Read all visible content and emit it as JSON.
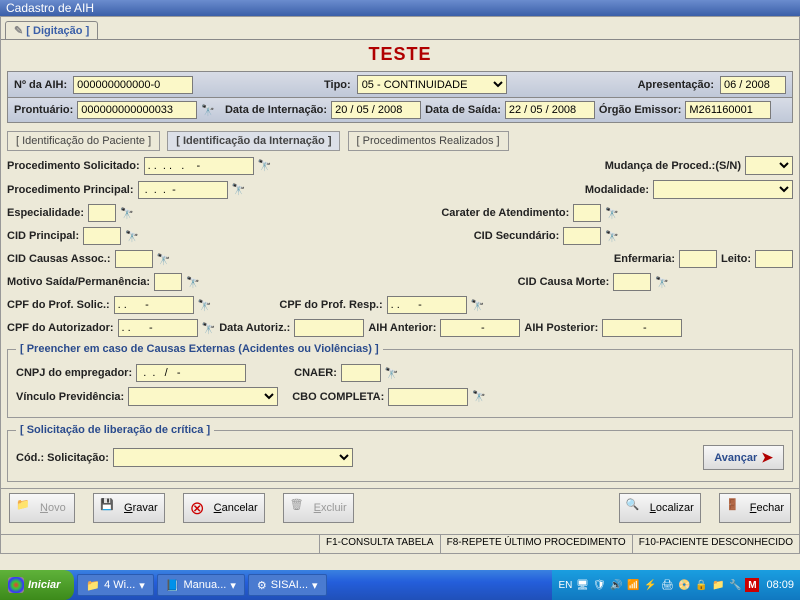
{
  "window": {
    "title": "Cadastro de AIH"
  },
  "tab": "[ Digitação ]",
  "heading": "TESTE",
  "top": {
    "naih_lbl": "Nº da AIH:",
    "naih": "000000000000-0",
    "tipo_lbl": "Tipo:",
    "tipo": "05 - CONTINUIDADE",
    "apres_lbl": "Apresentação:",
    "apres": "06 / 2008",
    "pront_lbl": "Prontuário:",
    "pront": "000000000000033",
    "dtint_lbl": "Data de Internação:",
    "dtint": "20 / 05 / 2008",
    "dtsai_lbl": "Data de Saída:",
    "dtsai": "22 / 05 / 2008",
    "emissor_lbl": "Órgão Emissor:",
    "emissor": "M261160001"
  },
  "sections": {
    "t1": "[ Identificação do Paciente ]",
    "t2": "[ Identificação da Internação ]",
    "t3": "[ Procedimentos Realizados ]"
  },
  "form": {
    "proc_solic": "Procedimento Solicitado:",
    "proc_solic_val": ". .  . .   .    -",
    "mud_proc": "Mudança de Proced.:(S/N)",
    "proc_princ": "Procedimento Principal:",
    "proc_princ_val": " .  .  .  - ",
    "modal": "Modalidade:",
    "espec": "Especialidade:",
    "carater": "Carater de Atendimento:",
    "cid_p": "CID Principal:",
    "cid_s": "CID Secundário:",
    "cid_ca": "CID Causas Assoc.:",
    "enferm": "Enfermaria:",
    "leito": "Leito:",
    "motivo": "Motivo Saída/Permanência:",
    "cid_morte": "CID Causa Morte:",
    "cpf_solic": "CPF do Prof. Solic.:",
    "cpf_solic_val": ". .      - ",
    "cpf_resp": "CPF do Prof. Resp.:",
    "cpf_resp_val": ". .      - ",
    "cpf_aut": "CPF do Autorizador:",
    "cpf_aut_val": ". .      - ",
    "dt_aut": "Data Autoriz.:",
    "aih_ant": "AIH Anterior:",
    "aih_ant_val": "            -",
    "aih_post": "AIH Posterior:",
    "aih_post_val": "            -"
  },
  "ext": {
    "legend": "[ Preencher em caso de Causas Externas (Acidentes ou Violências) ]",
    "cnpj": "CNPJ do empregador:",
    "cnpj_val": " .  .   /   -",
    "cnaer": "CNAER:",
    "vinculo": "Vínculo Previdência:",
    "cbo": "CBO COMPLETA:"
  },
  "crit": {
    "legend": "[ Solicitação de liberação de crítica ]",
    "cod": "Cód.: Solicitação:"
  },
  "avancar": "Avançar",
  "buttons": {
    "novo": "Novo",
    "gravar": "Gravar",
    "cancelar": "Cancelar",
    "excluir": "Excluir",
    "localizar": "Localizar",
    "fechar": "Fechar"
  },
  "status": {
    "f1": "F1-CONSULTA TABELA",
    "f8": "F8-REPETE ÚLTIMO PROCEDIMENTO",
    "f10": "F10-PACIENTE DESCONHECIDO"
  },
  "taskbar": {
    "start": "Iniciar",
    "t1": "4 Wi...",
    "t2": "Manua...",
    "t3": "SISAI...",
    "lang": "EN",
    "clock": "08:09"
  }
}
